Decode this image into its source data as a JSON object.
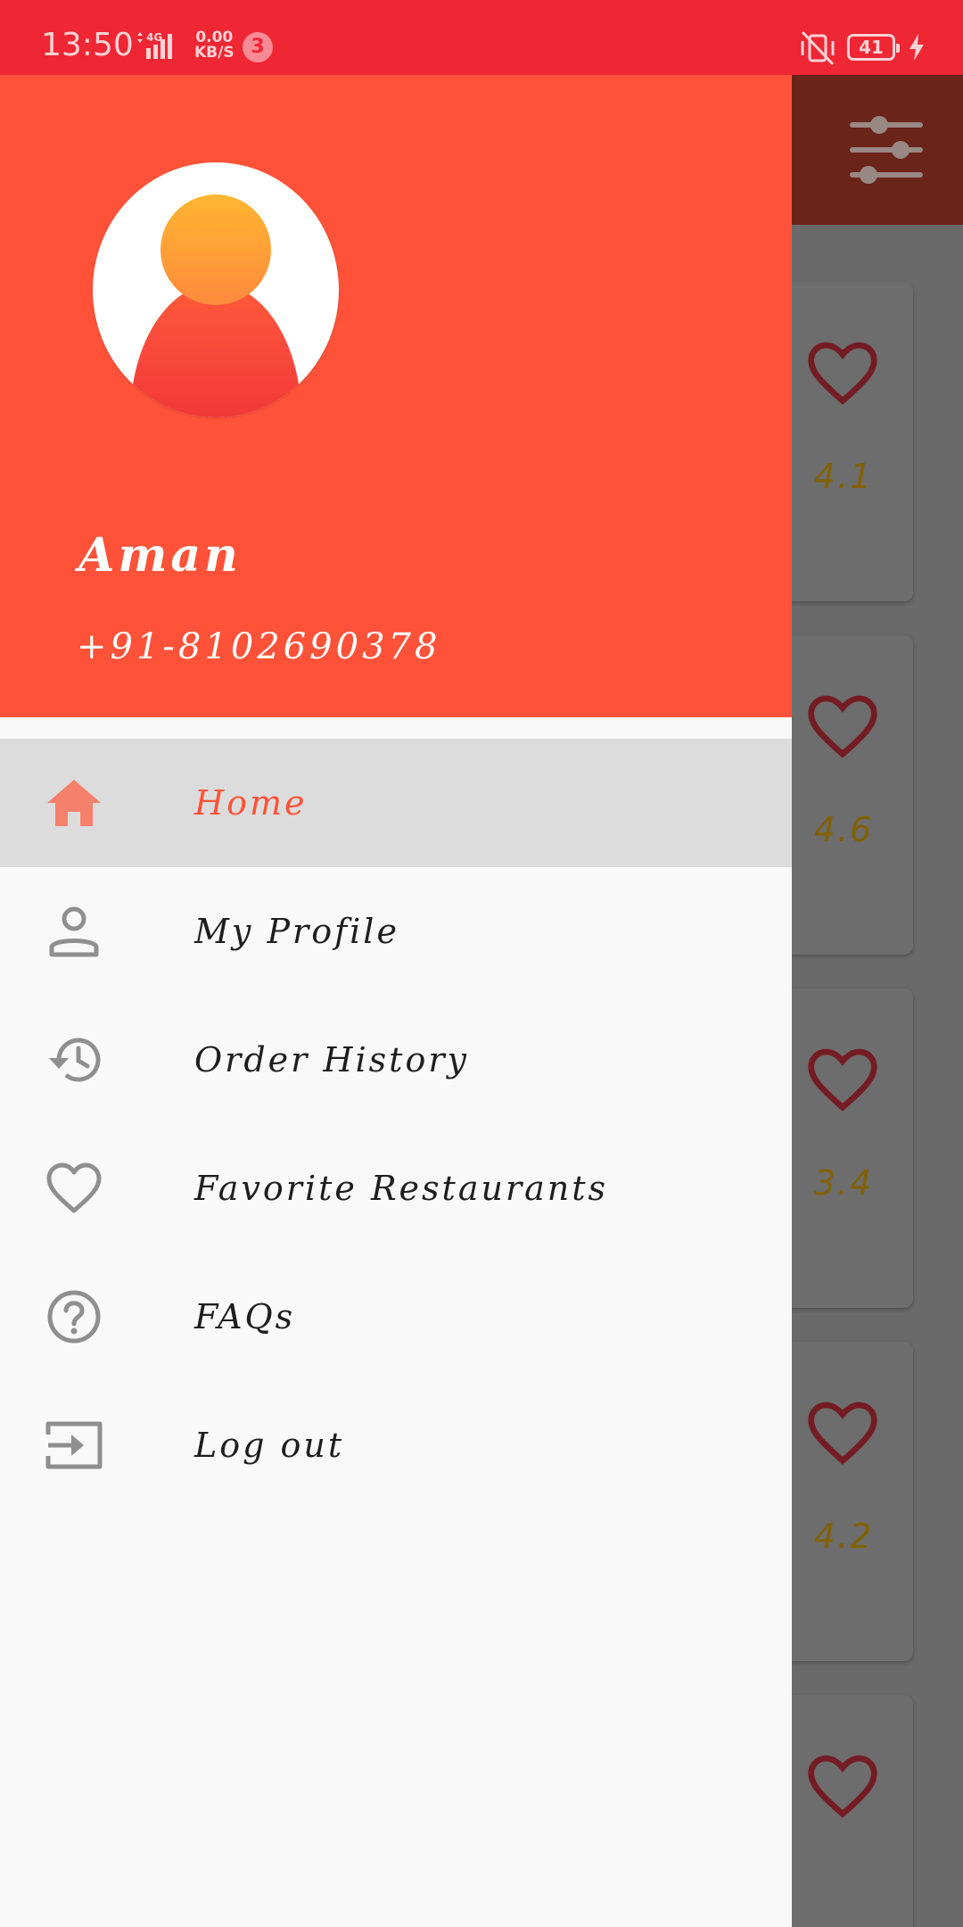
{
  "status_bar": {
    "time": "13:50",
    "network": "4G",
    "speed_value": "0.00",
    "speed_unit": "KB/S",
    "notification_count": "3",
    "battery": "41"
  },
  "drawer": {
    "user_name": "Aman",
    "user_phone": "+91-8102690378",
    "menu": [
      {
        "label": "Home",
        "icon": "home-icon",
        "active": true
      },
      {
        "label": "My Profile",
        "icon": "person-icon",
        "active": false
      },
      {
        "label": "Order History",
        "icon": "history-icon",
        "active": false
      },
      {
        "label": "Favorite Restaurants",
        "icon": "heart-outline-icon",
        "active": false
      },
      {
        "label": "FAQs",
        "icon": "help-circle-icon",
        "active": false
      },
      {
        "label": "Log out",
        "icon": "logout-icon",
        "active": false
      }
    ]
  },
  "background_list": {
    "ratings": [
      "4.1",
      "4.6",
      "3.4",
      "4.2"
    ]
  },
  "colors": {
    "status_bar": "#ef2633",
    "drawer_header": "#ff5238",
    "active_item": "#dcdcdc",
    "accent": "#ff5238"
  }
}
